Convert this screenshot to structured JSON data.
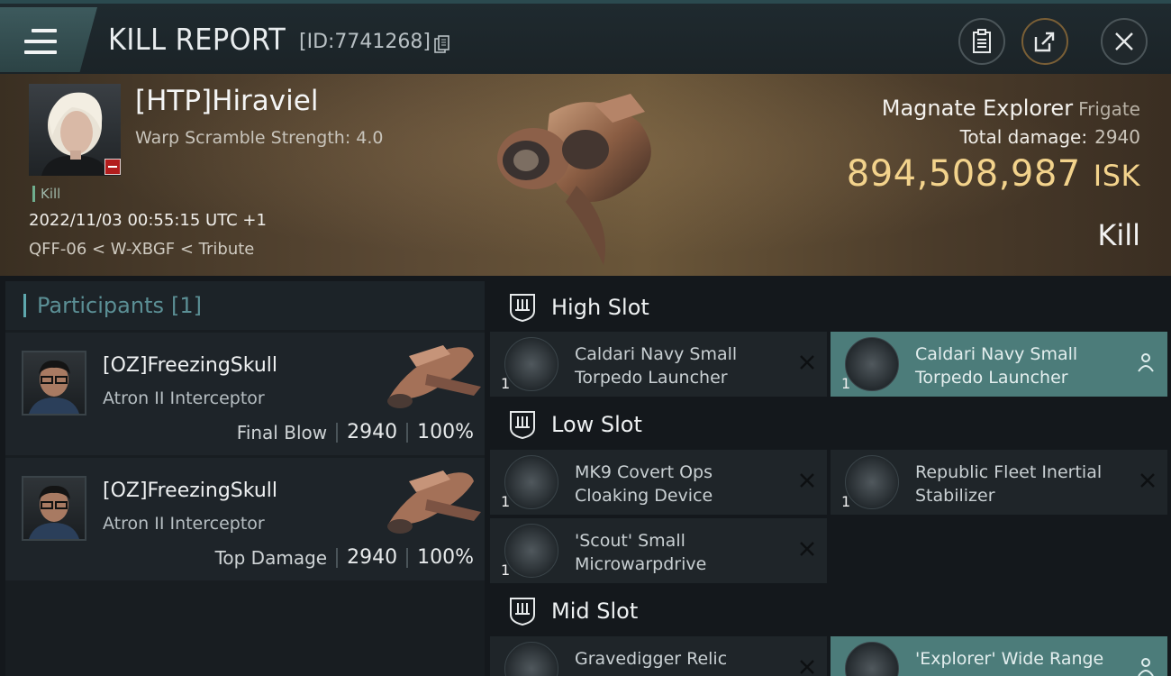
{
  "header": {
    "title": "KILL REPORT",
    "report_id": "[ID:7741268]"
  },
  "victim": {
    "name": "[HTP]Hiraviel",
    "warp_scramble": "Warp Scramble Strength: 4.0",
    "tag": "Kill",
    "datetime": "2022/11/03 00:55:15 UTC +1",
    "location": "QFF-06 < W-XBGF < Tribute",
    "ship": "Magnate Explorer",
    "ship_class": "Frigate",
    "total_damage_label": "Total damage:",
    "total_damage": "2940",
    "isk_value": "894,508,987",
    "isk_unit": "ISK",
    "result": "Kill"
  },
  "participants": {
    "label": "Participants",
    "count": "[1]",
    "rows": [
      {
        "name": "[OZ]FreezingSkull",
        "ship": "Atron II Interceptor",
        "role": "Final Blow",
        "damage": "2940",
        "percent": "100%"
      },
      {
        "name": "[OZ]FreezingSkull",
        "ship": "Atron II Interceptor",
        "role": "Top Damage",
        "damage": "2940",
        "percent": "100%"
      }
    ]
  },
  "fitting": {
    "high_slot": {
      "title": "High Slot",
      "modules": [
        {
          "name": "Caldari Navy Small Torpedo Launcher",
          "qty": "1",
          "status": "destroyed"
        },
        {
          "name": "Caldari Navy Small Torpedo Launcher",
          "qty": "1",
          "status": "dropped"
        }
      ]
    },
    "low_slot": {
      "title": "Low Slot",
      "modules": [
        {
          "name": "MK9 Covert Ops Cloaking Device",
          "qty": "1",
          "status": "destroyed"
        },
        {
          "name": "Republic Fleet Inertial Stabilizer",
          "qty": "1",
          "status": "destroyed"
        },
        {
          "name": "'Scout' Small Microwarpdrive",
          "qty": "1",
          "status": "destroyed"
        }
      ]
    },
    "mid_slot": {
      "title": "Mid Slot",
      "modules": [
        {
          "name": "Gravedigger Relic",
          "qty": "1",
          "status": "destroyed"
        },
        {
          "name": "'Explorer' Wide Range",
          "qty": "1",
          "status": "dropped"
        }
      ]
    }
  },
  "colors": {
    "accent_teal": "#4c7c7a",
    "isk_gold": "#f3d38c",
    "destroyed_red": "#b21d1d"
  },
  "icons": [
    "menu-icon",
    "copy-icon",
    "clipboard-icon",
    "share-icon",
    "close-icon",
    "slot-icon",
    "x-icon",
    "pilot-icon"
  ]
}
